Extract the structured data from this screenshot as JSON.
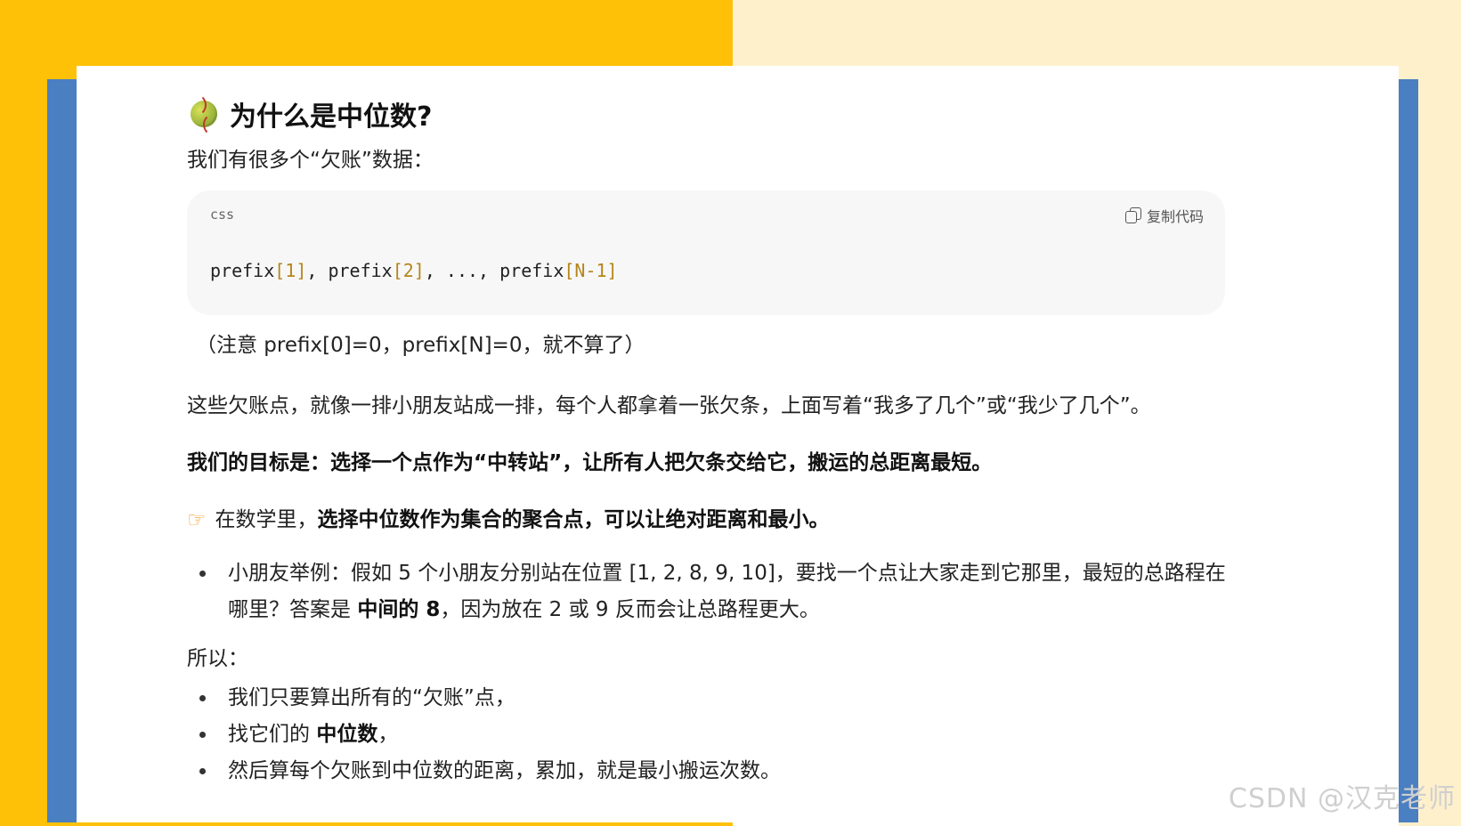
{
  "heading": {
    "icon": "softball-icon",
    "title": "为什么是中位数?"
  },
  "intro": "我们有很多个“欠账”数据：",
  "code_block": {
    "lang": "css",
    "copy_label": "复制代码",
    "tokens": [
      {
        "t": "prefix",
        "c": "plain"
      },
      {
        "t": "[1]",
        "c": "num"
      },
      {
        "t": ", prefix",
        "c": "plain"
      },
      {
        "t": "[2]",
        "c": "num"
      },
      {
        "t": ", ..., prefix",
        "c": "plain"
      },
      {
        "t": "[N-1]",
        "c": "num"
      }
    ]
  },
  "note": "（注意 prefix[0]=0，prefix[N]=0，就不算了）",
  "analogy": "这些欠账点，就像一排小朋友站成一排，每个人都拿着一张欠条，上面写着“我多了几个”或“我少了几个”。",
  "goal": "我们的目标是：选择一个点作为“中转站”，让所有人把欠条交给它，搬运的总距离最短。",
  "math_point": {
    "icon": "pointing-hand-icon",
    "prefix": "在数学里，",
    "bold": "选择中位数作为集合的聚合点，可以让绝对距离和最小。"
  },
  "example_list": [
    {
      "text_a": "小朋友举例：假如 5 个小朋友分别站在位置 [1, 2, 8, 9, 10]，要找一个点让大家走到它那里，最短的总路程在哪里？答案是 ",
      "bold": "中间的 8",
      "text_b": "，因为放在 2 或 9 反而会让总路程更大。"
    }
  ],
  "so_label": "所以：",
  "steps": [
    {
      "a": "我们只要算出所有的“欠账”点，",
      "bold": "",
      "b": ""
    },
    {
      "a": "找它们的 ",
      "bold": "中位数",
      "b": "，"
    },
    {
      "a": "然后算每个欠账到中位数的距离，累加，就是最小搬运次数。",
      "bold": "",
      "b": ""
    }
  ],
  "watermark": "CSDN @汉克老师",
  "colors": {
    "yellow": "#FFC107",
    "cream": "#FFF0CC",
    "blue": "#4A7FC1",
    "code_num": "#b5851a"
  }
}
